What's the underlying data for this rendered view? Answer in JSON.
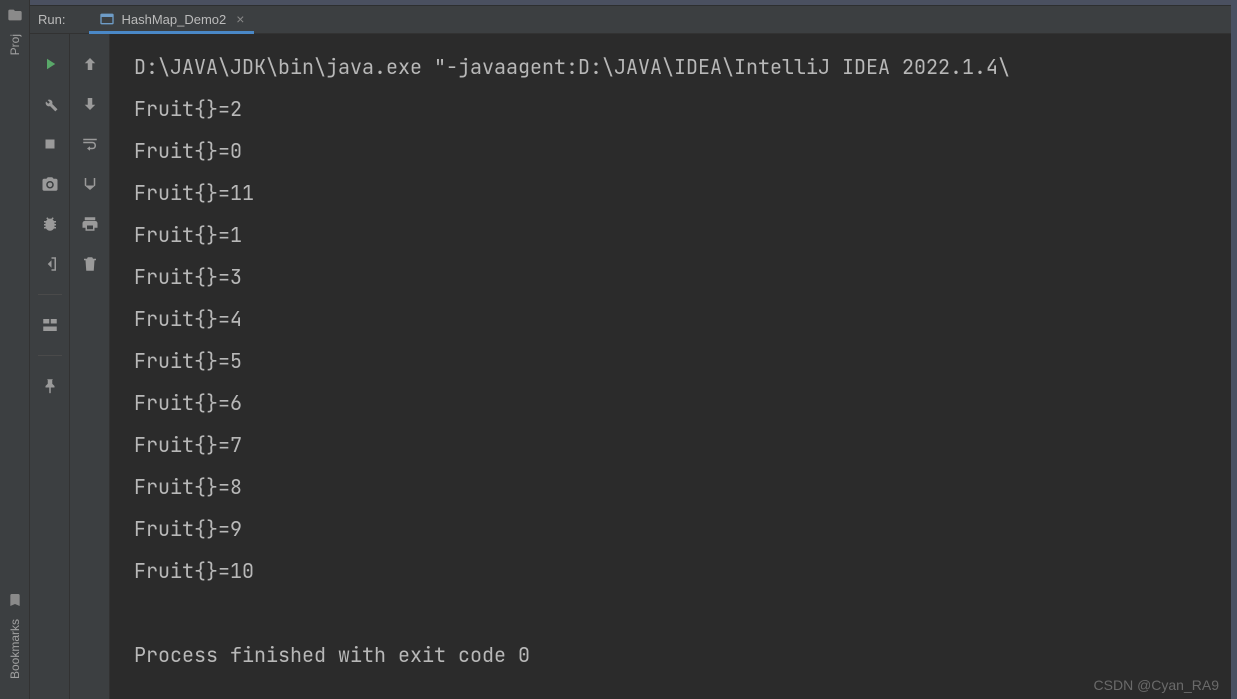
{
  "leftRail": {
    "topLabel": "Proj",
    "bottomLabel": "Bookmarks"
  },
  "tabBar": {
    "runLabel": "Run:",
    "tabName": "HashMap_Demo2"
  },
  "console": {
    "lines": [
      "D:\\JAVA\\JDK\\bin\\java.exe \"-javaagent:D:\\JAVA\\IDEA\\IntelliJ IDEA 2022.1.4\\",
      "Fruit{}=2",
      "Fruit{}=0",
      "Fruit{}=11",
      "Fruit{}=1",
      "Fruit{}=3",
      "Fruit{}=4",
      "Fruit{}=5",
      "Fruit{}=6",
      "Fruit{}=7",
      "Fruit{}=8",
      "Fruit{}=9",
      "Fruit{}=10",
      "",
      "Process finished with exit code 0"
    ]
  },
  "watermark": "CSDN @Cyan_RA9"
}
